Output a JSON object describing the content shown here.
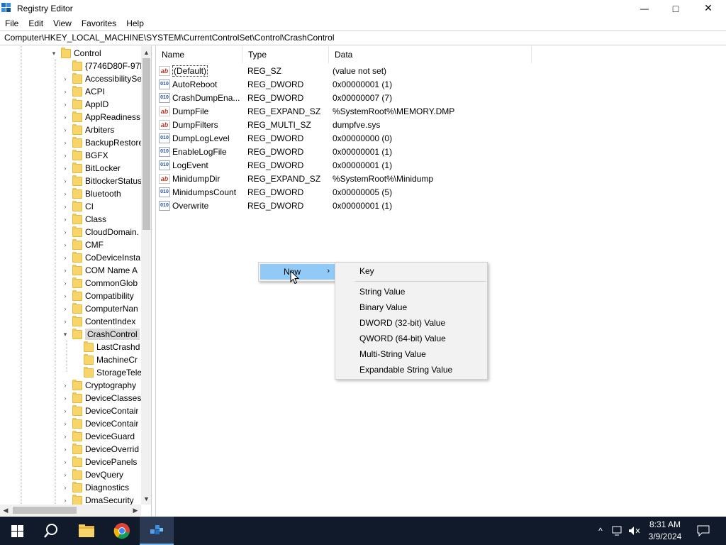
{
  "window": {
    "title": "Registry Editor",
    "minimize_glyph": "—",
    "maximize_glyph": "□",
    "close_glyph": "✕"
  },
  "menu": [
    "File",
    "Edit",
    "View",
    "Favorites",
    "Help"
  ],
  "address": "Computer\\HKEY_LOCAL_MACHINE\\SYSTEM\\CurrentControlSet\\Control\\CrashControl",
  "tree": {
    "root": "Control",
    "items": [
      "{7746D80F-97E",
      "AccessibilitySe",
      "ACPI",
      "AppID",
      "AppReadiness",
      "Arbiters",
      "BackupRestore",
      "BGFX",
      "BitLocker",
      "BitlockerStatus",
      "Bluetooth",
      "CI",
      "Class",
      "CloudDomain.",
      "CMF",
      "CoDeviceInsta",
      "COM Name A",
      "CommonGlob",
      "Compatibility",
      "ComputerNan",
      "ContentIndex"
    ],
    "selected": "CrashControl",
    "children": [
      "LastCrashd",
      "MachineCr",
      "StorageTele"
    ],
    "after": [
      "Cryptography",
      "DeviceClasses",
      "DeviceContair",
      "DeviceContair",
      "DeviceGuard",
      "DeviceOverrid",
      "DevicePanels",
      "DevQuery",
      "Diagnostics",
      "DmaSecurity"
    ]
  },
  "columns": {
    "name": "Name",
    "type": "Type",
    "data": "Data"
  },
  "values": [
    {
      "name": "(Default)",
      "type": "REG_SZ",
      "data": "(value not set)",
      "icon": "ab"
    },
    {
      "name": "AutoReboot",
      "type": "REG_DWORD",
      "data": "0x00000001 (1)",
      "icon": "010"
    },
    {
      "name": "CrashDumpEna...",
      "type": "REG_DWORD",
      "data": "0x00000007 (7)",
      "icon": "010"
    },
    {
      "name": "DumpFile",
      "type": "REG_EXPAND_SZ",
      "data": "%SystemRoot%\\MEMORY.DMP",
      "icon": "ab"
    },
    {
      "name": "DumpFilters",
      "type": "REG_MULTI_SZ",
      "data": "dumpfve.sys",
      "icon": "ab"
    },
    {
      "name": "DumpLogLevel",
      "type": "REG_DWORD",
      "data": "0x00000000 (0)",
      "icon": "010"
    },
    {
      "name": "EnableLogFile",
      "type": "REG_DWORD",
      "data": "0x00000001 (1)",
      "icon": "010"
    },
    {
      "name": "LogEvent",
      "type": "REG_DWORD",
      "data": "0x00000001 (1)",
      "icon": "010"
    },
    {
      "name": "MinidumpDir",
      "type": "REG_EXPAND_SZ",
      "data": "%SystemRoot%\\Minidump",
      "icon": "ab"
    },
    {
      "name": "MinidumpsCount",
      "type": "REG_DWORD",
      "data": "0x00000005 (5)",
      "icon": "010"
    },
    {
      "name": "Overwrite",
      "type": "REG_DWORD",
      "data": "0x00000001 (1)",
      "icon": "010"
    }
  ],
  "context_menu": {
    "new_label": "New",
    "submenu": [
      "Key",
      "String Value",
      "Binary Value",
      "DWORD (32-bit) Value",
      "QWORD (64-bit) Value",
      "Multi-String Value",
      "Expandable String Value"
    ]
  },
  "taskbar": {
    "time": "8:31 AM",
    "date": "3/9/2024"
  },
  "colors": {
    "taskbar": "#101a2a",
    "menu_highlight": "#91c9f7",
    "folder": "#f7d56b"
  }
}
